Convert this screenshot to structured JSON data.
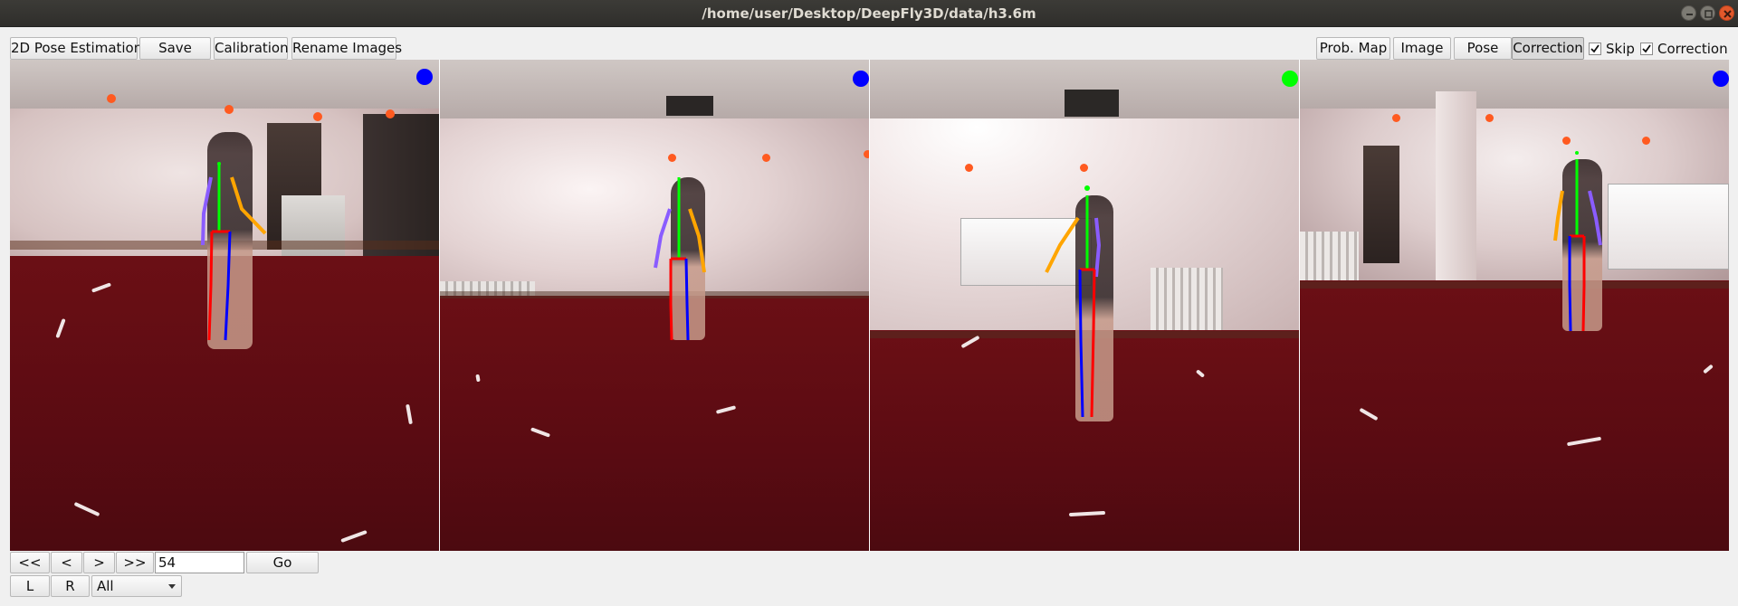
{
  "window": {
    "title": "/home/user/Desktop/DeepFly3D/data/h3.6m"
  },
  "toolbar_left": {
    "pose_estimation": "2D Pose Estimation",
    "save": "Save",
    "calibration": "Calibration",
    "rename_images": "Rename Images"
  },
  "toolbar_right": {
    "prob_map": "Prob. Map",
    "image": "Image",
    "pose": "Pose",
    "correction": "Correction",
    "active_mode": "Correction",
    "skip_checkbox": {
      "label": "Skip",
      "checked": true
    },
    "correction_checkbox": {
      "label": "Correction",
      "checked": true
    }
  },
  "cameras": [
    {
      "indicator_color": "#0000ff"
    },
    {
      "indicator_color": "#0000ff"
    },
    {
      "indicator_color": "#00ff00"
    },
    {
      "indicator_color": "#0000ff"
    }
  ],
  "skeleton_colors": {
    "spine": "#00ff00",
    "right_arm": "#ffa500",
    "left_arm": "#8a5cff",
    "right_leg": "#ff0000",
    "left_leg": "#0000ff"
  },
  "navigation": {
    "first": "<<",
    "prev": "<",
    "next": ">",
    "last": ">>",
    "frame_value": "54",
    "go": "Go",
    "left": "L",
    "right": "R",
    "view_select": "All"
  }
}
